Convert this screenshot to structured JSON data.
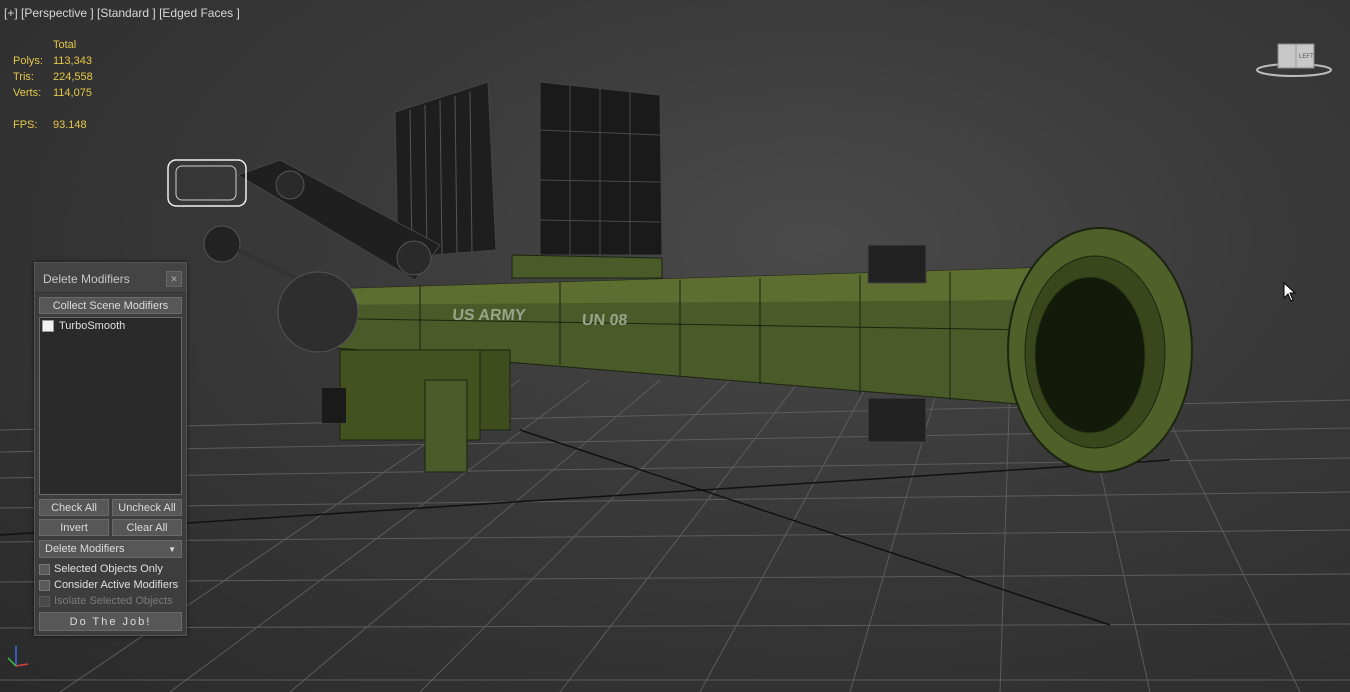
{
  "viewport": {
    "label": "[+] [Perspective ] [Standard ] [Edged Faces ]",
    "stats": {
      "header": "Total",
      "rows": [
        {
          "key": "Polys:",
          "value": "113,343"
        },
        {
          "key": "Tris:",
          "value": "224,558"
        },
        {
          "key": "Verts:",
          "value": "114,075"
        }
      ],
      "fps_key": "FPS:",
      "fps_value": "93.148"
    },
    "model_text": {
      "left": "US ARMY",
      "right": "UN 08"
    },
    "viewcube": {
      "left_face": "LEFT"
    }
  },
  "dialog": {
    "title": "Delete Modifiers",
    "collect_button": "Collect Scene Modifiers",
    "list_items": [
      {
        "label": "TurboSmooth",
        "checked": false
      }
    ],
    "check_all": "Check All",
    "uncheck_all": "Uncheck All",
    "invert": "Invert",
    "clear_all": "Clear All",
    "dropdown_value": "Delete Modifiers",
    "options": [
      {
        "label": "Selected Objects Only",
        "enabled": true
      },
      {
        "label": "Consider Active Modifiers",
        "enabled": true
      },
      {
        "label": "Isolate Selected Objects",
        "enabled": false
      }
    ],
    "do_button": "Do The Job!"
  },
  "colors": {
    "stats": "#e5c84a",
    "model_green": "#4a5a28",
    "wire": "#1c2410"
  }
}
